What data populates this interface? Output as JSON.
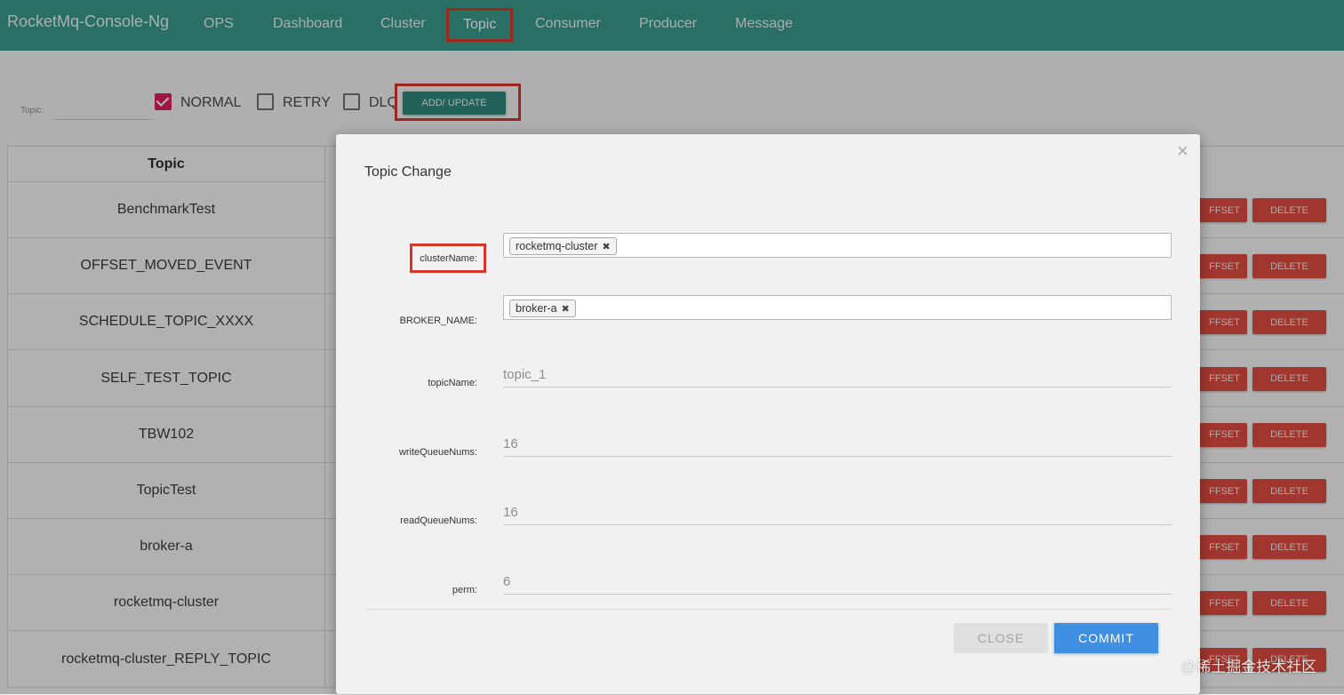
{
  "navbar": {
    "brand": "RocketMq-Console-Ng",
    "items": [
      "OPS",
      "Dashboard",
      "Cluster",
      "Topic",
      "Consumer",
      "Producer",
      "Message"
    ],
    "active": "Topic"
  },
  "filter": {
    "label": "Topic:",
    "value": "",
    "checkboxes": [
      {
        "label": "NORMAL",
        "checked": true
      },
      {
        "label": "RETRY",
        "checked": false
      },
      {
        "label": "DLQ",
        "checked": false
      }
    ],
    "add_button": "ADD/ UPDATE"
  },
  "table": {
    "header_topic": "Topic",
    "rows": [
      "BenchmarkTest",
      "OFFSET_MOVED_EVENT",
      "SCHEDULE_TOPIC_XXXX",
      "SELF_TEST_TOPIC",
      "TBW102",
      "TopicTest",
      "broker-a",
      "rocketmq-cluster",
      "rocketmq-cluster_REPLY_TOPIC"
    ],
    "offset_button": "FFSET",
    "delete_button": "DELETE"
  },
  "modal": {
    "close_icon": "×",
    "title": "Topic Change",
    "fields": {
      "cluster_label": "clusterName:",
      "cluster_tag": "rocketmq-cluster",
      "broker_label": "BROKER_NAME:",
      "broker_tag": "broker-a",
      "topic_label": "topicName:",
      "topic_value": "topic_1",
      "write_label": "writeQueueNums:",
      "write_value": "16",
      "read_label": "readQueueNums:",
      "read_value": "16",
      "perm_label": "perm:",
      "perm_value": "6"
    },
    "tag_remove_icon": "✖",
    "close_button": "CLOSE",
    "commit_button": "COMMIT"
  },
  "watermark": "@稀土掘金技术社区",
  "colors": {
    "navbar": "#3b9a8a",
    "highlight": "#d9362b",
    "delete": "#de4b3f",
    "commit": "#3f8fe3",
    "checkbox": "#e11d63"
  }
}
